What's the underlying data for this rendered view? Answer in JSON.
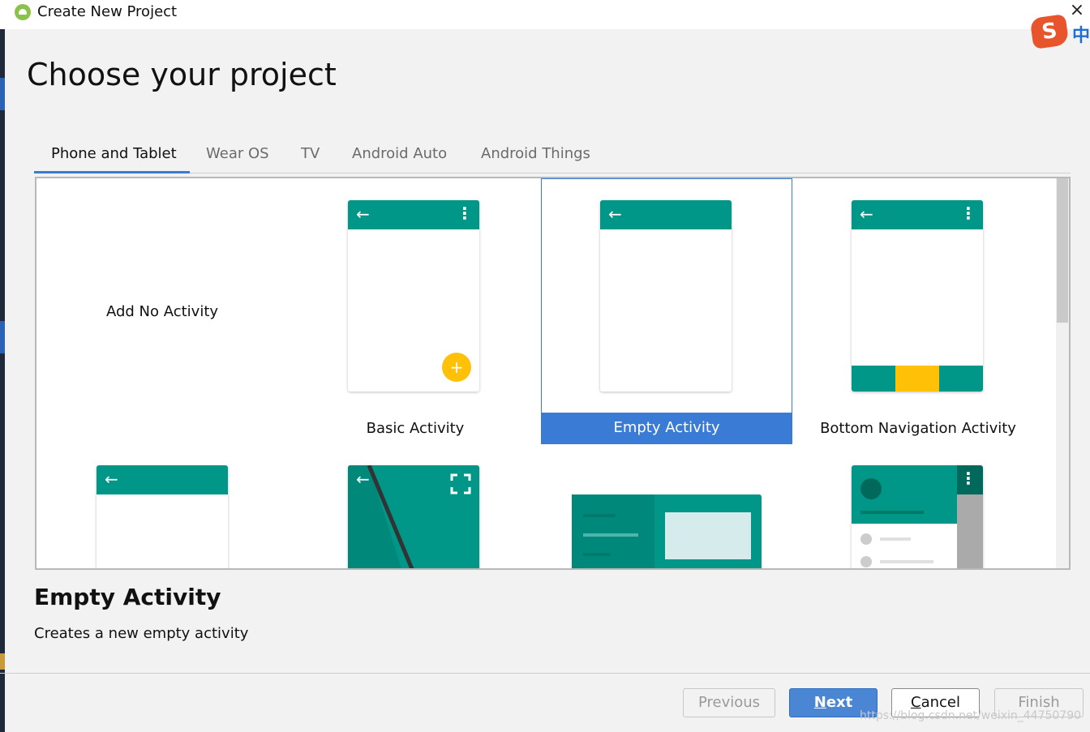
{
  "window": {
    "title": "Create New Project",
    "close_icon": "×",
    "ime_logo": "S",
    "ime_mode": "中"
  },
  "page": {
    "title": "Choose your project"
  },
  "tabs": [
    {
      "label": "Phone and Tablet",
      "active": true
    },
    {
      "label": "Wear OS",
      "active": false
    },
    {
      "label": "TV",
      "active": false
    },
    {
      "label": "Android Auto",
      "active": false
    },
    {
      "label": "Android Things",
      "active": false
    }
  ],
  "templates": {
    "items": [
      {
        "label": "Add No Activity",
        "selected": false
      },
      {
        "label": "Basic Activity",
        "selected": false
      },
      {
        "label": "Empty Activity",
        "selected": true
      },
      {
        "label": "Bottom Navigation Activity",
        "selected": false
      }
    ],
    "icons": {
      "back": "←",
      "overflow": "⋮",
      "fab": "+"
    }
  },
  "selection": {
    "title": "Empty Activity",
    "description": "Creates a new empty activity"
  },
  "buttons": {
    "previous": "Previous",
    "next_mnemonic": "N",
    "next_rest": "ext",
    "cancel_mnemonic": "C",
    "cancel_rest": "ancel",
    "finish": "Finish"
  },
  "watermark": "https://blog.csdn.net/weixin_44750790",
  "colors": {
    "accent": "#3a7bd5",
    "teal": "#009688",
    "amber": "#ffc107"
  }
}
